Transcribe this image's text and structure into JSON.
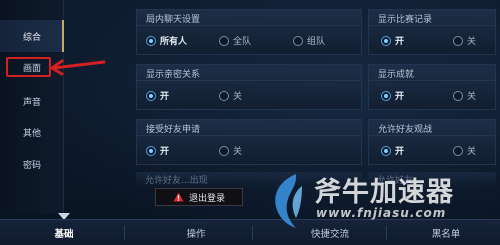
{
  "sidebar": {
    "items": [
      {
        "label": "综合",
        "active": true
      },
      {
        "label": "画面",
        "active": false,
        "highlighted": true
      },
      {
        "label": "声音",
        "active": false
      },
      {
        "label": "其他",
        "active": false
      },
      {
        "label": "密码",
        "active": false
      }
    ]
  },
  "settings": {
    "chat": {
      "title": "局内聊天设置",
      "options": [
        "所有人",
        "全队",
        "组队"
      ],
      "selected": "所有人"
    },
    "match_record": {
      "title": "显示比赛记录",
      "options": [
        "开",
        "关"
      ],
      "selected": "开"
    },
    "relationship": {
      "title": "显示亲密关系",
      "options": [
        "开",
        "关"
      ],
      "selected": "开"
    },
    "achievement": {
      "title": "显示成就",
      "options": [
        "开",
        "关"
      ],
      "selected": "开"
    },
    "friend_request": {
      "title": "接受好友申请",
      "options": [
        "开",
        "关"
      ],
      "selected": "开"
    },
    "friend_watch": {
      "title": "允许好友观战",
      "options": [
        "开",
        "关"
      ],
      "selected": "开"
    },
    "more_left": {
      "title": "允许好友...出现"
    },
    "more_right": {
      "title": "允许好友..."
    }
  },
  "logout": {
    "label": "退出登录"
  },
  "tabs": [
    {
      "label": "基础",
      "active": true
    },
    {
      "label": "操作",
      "active": false
    },
    {
      "label": "快捷交流",
      "active": false
    },
    {
      "label": "黑名单",
      "active": false
    }
  ],
  "watermark": {
    "title": "斧牛加速器",
    "url": "www.fnjiasu.com"
  },
  "colors": {
    "accent": "#4aa6e8",
    "highlight": "#d42020",
    "gold": "#c8a868"
  }
}
